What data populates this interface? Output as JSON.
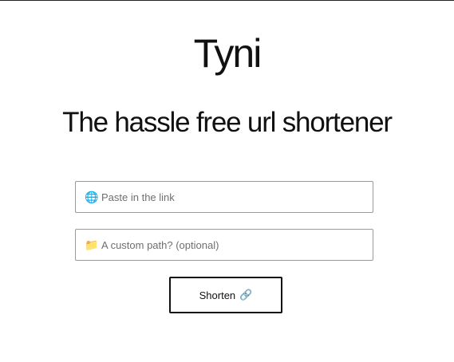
{
  "header": {
    "title": "Tyni",
    "subtitle": "The hassle free url shortener"
  },
  "form": {
    "link_field": {
      "icon": "globe-icon",
      "icon_glyph": "🌐",
      "placeholder": "Paste in the link",
      "value": ""
    },
    "path_field": {
      "icon": "folder-icon",
      "icon_glyph": "📁",
      "placeholder": "A custom path? (optional)",
      "value": ""
    },
    "submit": {
      "label": "Shorten",
      "icon": "link-icon",
      "icon_glyph": "🔗"
    }
  },
  "colors": {
    "text": "#111111",
    "border": "#9a9a9a",
    "placeholder": "#6f6f6f",
    "background": "#ffffff"
  }
}
